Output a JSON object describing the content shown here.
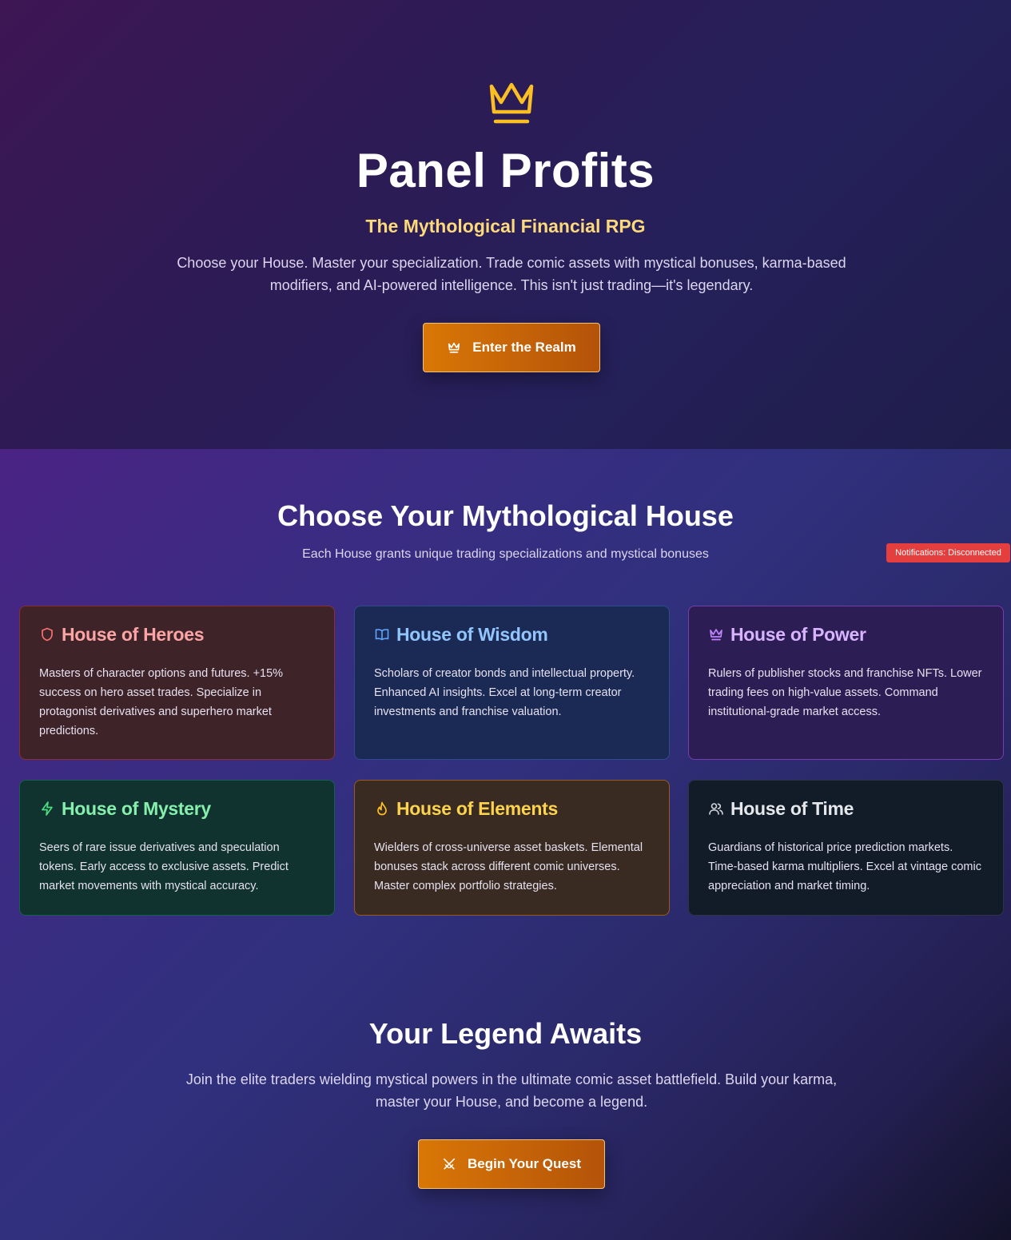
{
  "hero": {
    "icon": "crown-icon",
    "title": "Panel Profits",
    "subtitle": "The Mythological Financial RPG",
    "description": "Choose your House. Master your specialization. Trade comic assets with mystical bonuses, karma-based modifiers, and AI-powered intelligence. This isn't just trading—it's legendary.",
    "cta": {
      "label": "Enter the Realm",
      "icon": "crown-icon"
    }
  },
  "houses_section": {
    "title": "Choose Your Mythological House",
    "subtitle": "Each House grants unique trading specializations and mystical bonuses",
    "houses": [
      {
        "name": "House of Heroes",
        "icon": "shield-icon",
        "color": "#fca5a5",
        "description": "Masters of character options and futures. +15% success on hero asset trades. Specialize in protagonist derivatives and superhero market predictions."
      },
      {
        "name": "House of Wisdom",
        "icon": "book-icon",
        "color": "#93c5fd",
        "description": "Scholars of creator bonds and intellectual property. Enhanced AI insights. Excel at long-term creator investments and franchise valuation."
      },
      {
        "name": "House of Power",
        "icon": "crown-icon",
        "color": "#d8b4fe",
        "description": "Rulers of publisher stocks and franchise NFTs. Lower trading fees on high-value assets. Command institutional-grade market access."
      },
      {
        "name": "House of Mystery",
        "icon": "lightning-icon",
        "color": "#86efac",
        "description": "Seers of rare issue derivatives and speculation tokens. Early access to exclusive assets. Predict market movements with mystical accuracy."
      },
      {
        "name": "House of Elements",
        "icon": "flame-icon",
        "color": "#fcd34d",
        "description": "Wielders of cross-universe asset baskets. Elemental bonuses stack across different comic universes. Master complex portfolio strategies."
      },
      {
        "name": "House of Time",
        "icon": "users-icon",
        "color": "#e5e7eb",
        "description": "Guardians of historical price prediction markets. Time-based karma multipliers. Excel at vintage comic appreciation and market timing."
      }
    ]
  },
  "notification_badge": {
    "text": "Notifications: Disconnected",
    "color": "#e53e3e"
  },
  "legend_section": {
    "title": "Your Legend Awaits",
    "description": "Join the elite traders wielding mystical powers in the ultimate comic asset battlefield. Build your karma, master your House, and become a legend.",
    "cta": {
      "label": "Begin Your Quest",
      "icon": "swords-icon"
    }
  },
  "colors": {
    "accent": "#d97706",
    "gold": "#fcd97a"
  }
}
